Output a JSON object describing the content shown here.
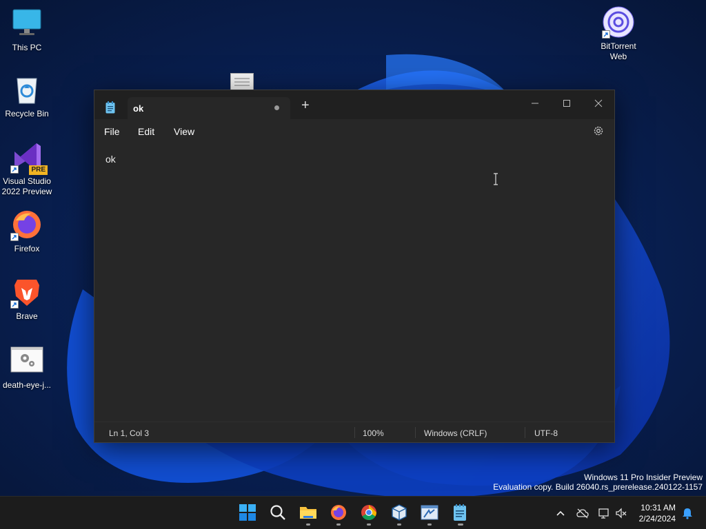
{
  "desktop": {
    "icons": [
      {
        "label": "This PC"
      },
      {
        "label": "Recycle Bin"
      },
      {
        "label": "Visual Studio 2022 Preview",
        "badge": "PRE"
      },
      {
        "label": "Firefox"
      },
      {
        "label": "Brave"
      },
      {
        "label": "death-eye-j..."
      },
      {
        "label": "BitTorrent Web"
      }
    ]
  },
  "notepad": {
    "tab_title": "ok",
    "new_tab": "+",
    "menu": {
      "file": "File",
      "edit": "Edit",
      "view": "View"
    },
    "content": "ok",
    "status": {
      "position": "Ln 1, Col 3",
      "zoom": "100%",
      "line_ending": "Windows (CRLF)",
      "encoding": "UTF-8"
    }
  },
  "watermark": {
    "line1": "Windows 11 Pro Insider Preview",
    "line2": "Evaluation copy. Build 26040.rs_prerelease.240122-1157"
  },
  "taskbar": {
    "clock": {
      "time": "10:31 AM",
      "date": "2/24/2024"
    },
    "apps": [
      "start-icon",
      "search-icon",
      "file-explorer-icon",
      "firefox-icon",
      "chrome-icon",
      "virtualbox-icon",
      "settings-app-icon",
      "notepad-icon"
    ]
  },
  "colors": {
    "accent": "#0a6cff",
    "window_bg": "#272727",
    "titlebar_bg": "#202020"
  }
}
